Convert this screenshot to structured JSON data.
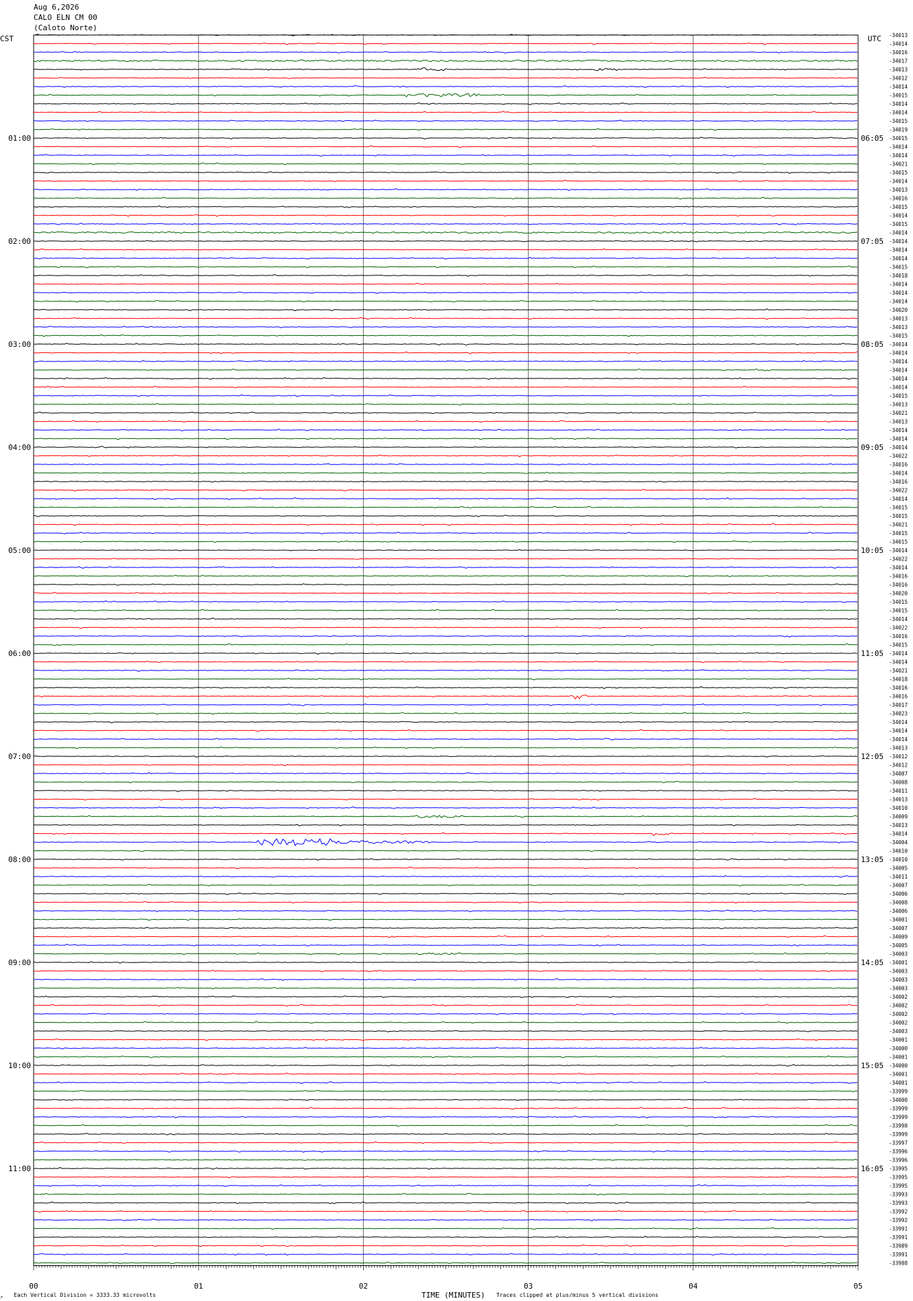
{
  "header": {
    "date": "Aug 6,2026",
    "station": "CALO ELN CM 00",
    "place": "(Caloto Norte)",
    "left_zone": "CST",
    "right_zone": "UTC"
  },
  "footer": {
    "scale_note": "Each Vertical Division = 3333.33 microvolts",
    "xlabel": "TIME (MINUTES)",
    "clip_note": "Traces clipped at plus/minus 5 vertical divisions"
  },
  "colors": {
    "trace_cycle": [
      "#000000",
      "#ff0000",
      "#0000ff",
      "#006400"
    ],
    "grid": "#808080"
  },
  "chart_data": {
    "type": "line",
    "title": "CALO ELN CM 00",
    "x_axis": {
      "label": "TIME (MINUTES)",
      "range": [
        0,
        5
      ],
      "ticks": [
        "00",
        "01",
        "02",
        "03",
        "04",
        "05"
      ]
    },
    "left_hour_labels": [
      {
        "row": 12,
        "label": "01:00"
      },
      {
        "row": 24,
        "label": "02:00"
      },
      {
        "row": 36,
        "label": "03:00"
      },
      {
        "row": 48,
        "label": "04:00"
      },
      {
        "row": 60,
        "label": "05:00"
      },
      {
        "row": 72,
        "label": "06:00"
      },
      {
        "row": 84,
        "label": "07:00"
      },
      {
        "row": 96,
        "label": "08:00"
      },
      {
        "row": 108,
        "label": "09:00"
      },
      {
        "row": 120,
        "label": "10:00"
      },
      {
        "row": 132,
        "label": "11:00"
      }
    ],
    "right_hour_labels": [
      {
        "row": 12,
        "label": "06:05"
      },
      {
        "row": 24,
        "label": "07:05"
      },
      {
        "row": 36,
        "label": "08:05"
      },
      {
        "row": 48,
        "label": "09:05"
      },
      {
        "row": 60,
        "label": "10:05"
      },
      {
        "row": 72,
        "label": "11:05"
      },
      {
        "row": 84,
        "label": "12:05"
      },
      {
        "row": 96,
        "label": "13:05"
      },
      {
        "row": 108,
        "label": "14:05"
      },
      {
        "row": 120,
        "label": "15:05"
      },
      {
        "row": 132,
        "label": "16:05"
      }
    ],
    "row_offsets": [
      "-34013",
      "-34014",
      "-34016",
      "-34017",
      "-34013",
      "-34012",
      "-34014",
      "-34015",
      "-34014",
      "-34014",
      "-34015",
      "-34019",
      "-34015",
      "-34014",
      "-34014",
      "-34021",
      "-34015",
      "-34014",
      "-34013",
      "-34016",
      "-34015",
      "-34014",
      "-34015",
      "-34014",
      "-34014",
      "-34014",
      "-34014",
      "-34015",
      "-34018",
      "-34014",
      "-34014",
      "-34014",
      "-34020",
      "-34013",
      "-34013",
      "-34015",
      "-34014",
      "-34014",
      "-34014",
      "-34014",
      "-34014",
      "-34014",
      "-34015",
      "-34013",
      "-34021",
      "-34013",
      "-34014",
      "-34014",
      "-34014",
      "-34022",
      "-34016",
      "-34014",
      "-34016",
      "-34022",
      "-34014",
      "-34015",
      "-34015",
      "-34021",
      "-34015",
      "-34015",
      "-34014",
      "-34022",
      "-34014",
      "-34016",
      "-34016",
      "-34020",
      "-34015",
      "-34015",
      "-34014",
      "-34022",
      "-34016",
      "-34015",
      "-34014",
      "-34014",
      "-34021",
      "-34018",
      "-34016",
      "-34016",
      "-34017",
      "-34023",
      "-34014",
      "-34014",
      "-34014",
      "-34013",
      "-34012",
      "-34012",
      "-34007",
      "-34008",
      "-34011",
      "-34013",
      "-34010",
      "-34009",
      "-34013",
      "-34014",
      "-34004",
      "-34010",
      "-34010",
      "-34005",
      "-34011",
      "-34007",
      "-34006",
      "-34008",
      "-34006",
      "-34001",
      "-34007",
      "-34009",
      "-34005",
      "-34003",
      "-34001",
      "-34003",
      "-34003",
      "-34003",
      "-34002",
      "-34002",
      "-34002",
      "-34002",
      "-34003",
      "-34001",
      "-34000",
      "-34001",
      "-34000",
      "-34001",
      "-34001",
      "-33999",
      "-34000",
      "-33999",
      "-33999",
      "-33998",
      "-33999",
      "-33997",
      "-33996",
      "-33996",
      "-33995",
      "-33995",
      "-33995",
      "-33993",
      "-33993",
      "-33992",
      "-33992",
      "-33991",
      "-33991",
      "-33989",
      "-33991",
      "-33988"
    ],
    "events": [
      {
        "row": 3,
        "start": 0.0,
        "end": 5.0,
        "amp": 1.0
      },
      {
        "row": 4,
        "start": 2.33,
        "end": 2.5,
        "amp": 2.5
      },
      {
        "row": 4,
        "start": 3.4,
        "end": 3.55,
        "amp": 1.8
      },
      {
        "row": 7,
        "start": 2.25,
        "end": 2.7,
        "amp": 2.5
      },
      {
        "row": 23,
        "start": 0.0,
        "end": 5.0,
        "amp": 1.0
      },
      {
        "row": 77,
        "start": 3.25,
        "end": 3.35,
        "amp": 4.0
      },
      {
        "row": 91,
        "start": 2.3,
        "end": 2.6,
        "amp": 2.0
      },
      {
        "row": 93,
        "start": 3.75,
        "end": 3.85,
        "amp": 3.0
      },
      {
        "row": 94,
        "start": 1.35,
        "end": 1.8,
        "amp": 5.0
      },
      {
        "row": 94,
        "start": 1.8,
        "end": 2.4,
        "amp": 2.0
      },
      {
        "row": 107,
        "start": 2.3,
        "end": 2.6,
        "amp": 1.5
      }
    ]
  }
}
